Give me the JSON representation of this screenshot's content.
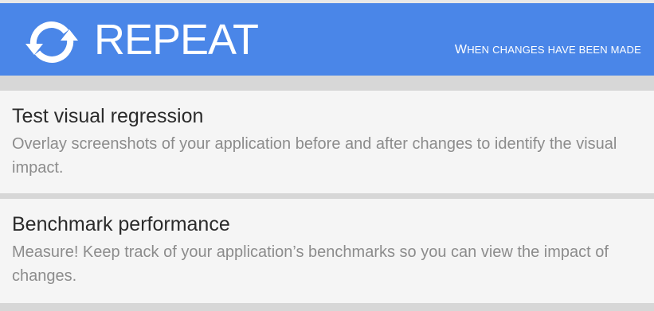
{
  "header": {
    "title": "REPEAT",
    "subtitle_first": "W",
    "subtitle_rest": "hen changes have been made",
    "icon": "refresh-icon",
    "background": "#4a86e8"
  },
  "items": [
    {
      "title": "Test visual regression",
      "description": "Overlay screenshots of your application before and after changes to identify the visual impact."
    },
    {
      "title": "Benchmark performance",
      "description": "Measure! Keep track of your application’s benchmarks so you can view the impact of changes."
    }
  ]
}
